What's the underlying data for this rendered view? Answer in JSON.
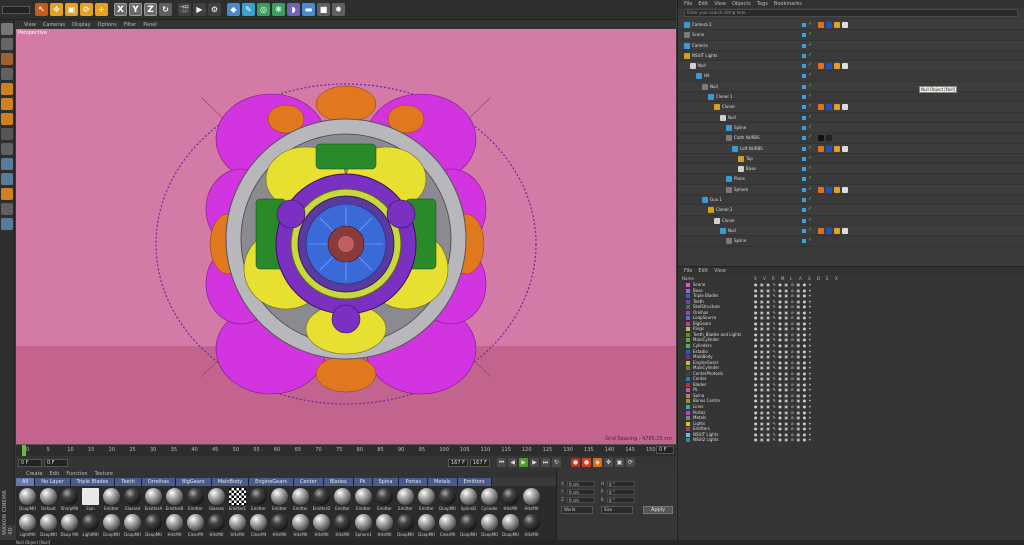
{
  "toolbar": {
    "undo_field": "",
    "xyz": [
      "X",
      "Y",
      "Z"
    ],
    "mode_icons": [
      "move-icon",
      "scale-icon",
      "rotate-icon",
      "live-select-icon",
      "cube-icon",
      "pen-icon",
      "subdivision-icon",
      "array-icon",
      "deformer-icon",
      "camera-icon",
      "light-icon"
    ]
  },
  "viewport": {
    "menu": [
      "View",
      "Cameras",
      "Display",
      "Options",
      "Filter",
      "Panel"
    ],
    "label": "Perspective",
    "grid_spacing": "Grid Spacing : 4765.25 cm"
  },
  "timeline": {
    "ticks": [
      "0",
      "5",
      "10",
      "15",
      "20",
      "25",
      "30",
      "35",
      "40",
      "45",
      "50",
      "55",
      "60",
      "65",
      "70",
      "75",
      "80",
      "85",
      "90",
      "95",
      "100",
      "105",
      "110",
      "115",
      "120",
      "125",
      "130",
      "135",
      "140",
      "145",
      "150"
    ],
    "start_frame": "0 F",
    "current_frame": "0 F",
    "end_frame": "167 F",
    "max_frame": "167 F",
    "frame_indicator": "0 F"
  },
  "material_manager": {
    "menu": [
      "Create",
      "Edit",
      "Function",
      "Texture"
    ],
    "tabs": [
      "All",
      "No Layer",
      "Triple Blades",
      "Teeth",
      "Orrelhas",
      "BigGears",
      "MainBody",
      "EngineGears",
      "Center",
      "Blades",
      "Pk",
      "Spina",
      "Portas",
      "Metals",
      "Emitters"
    ],
    "row1": [
      "DoopMtl",
      "Default",
      "SharpMtl",
      "Sian",
      "Emitter",
      "Glassed",
      "EmitterA",
      "EmitterB",
      "Emitter",
      "Glasses",
      "EmitterC",
      "Emitter",
      "Emitter",
      "Emitter",
      "EmitterD",
      "Emitter",
      "Emitter",
      "Emitter",
      "Emitter",
      "Emitter",
      "DoopMtl",
      "SplineD",
      "Cylinder",
      "HitsMtl",
      "HitsMtl",
      "LightMtl"
    ],
    "row2": [
      "DoopMtl",
      "Doop Mtl",
      "LightMtl",
      "DoopMtl",
      "DoopMtl",
      "DoopMtl",
      "HitsMtl",
      "ClearMt",
      "HitsMtl",
      "HitsMtl",
      "ClearMt",
      "HitsMtl",
      "HitsMtl",
      "HitsMtl",
      "HitsMtl",
      "Sphere1",
      "HitsMtl",
      "DoopMtl",
      "DoopMtl",
      "ClearMt",
      "DoopMtl",
      "DoopMtl",
      "DoopMtl",
      "HitsMtl",
      "HitsMtl",
      "ClearMt"
    ]
  },
  "attributes": {
    "labels": [
      "X",
      "Y",
      "Z",
      "H",
      "P",
      "B"
    ],
    "values": [
      "0 cm",
      "0 cm",
      "0 cm",
      "0 °",
      "0 °",
      "0 °"
    ],
    "world": "World",
    "size": "Size",
    "apply": "Apply"
  },
  "object_manager": {
    "menu": [
      "File",
      "Edit",
      "View",
      "Objects",
      "Tags",
      "Bookmarks"
    ],
    "search_placeholder": "Enter your search string here",
    "tooltip": "Null Object [Null]",
    "rows": [
      {
        "name": "Camera.1",
        "indent": 0
      },
      {
        "name": "Scene",
        "indent": 0
      },
      {
        "name": "Camera",
        "indent": 0
      },
      {
        "name": "NSUIT Lights",
        "indent": 0
      },
      {
        "name": "Null",
        "indent": 1
      },
      {
        "name": "Hit",
        "indent": 2
      },
      {
        "name": "Null",
        "indent": 3
      },
      {
        "name": "Cloner.1",
        "indent": 4
      },
      {
        "name": "Cloner",
        "indent": 5
      },
      {
        "name": "Null",
        "indent": 6
      },
      {
        "name": "Spline",
        "indent": 7
      },
      {
        "name": "Cloth NURBS",
        "indent": 7
      },
      {
        "name": "Loft NURBS",
        "indent": 8
      },
      {
        "name": "Top",
        "indent": 9
      },
      {
        "name": "Base",
        "indent": 9
      },
      {
        "name": "Plane",
        "indent": 7
      },
      {
        "name": "Sphere",
        "indent": 7
      },
      {
        "name": "Gun.1",
        "indent": 3
      },
      {
        "name": "Cloner.1",
        "indent": 4
      },
      {
        "name": "Cloner",
        "indent": 5
      },
      {
        "name": "Null",
        "indent": 6
      },
      {
        "name": "Spline",
        "indent": 7
      }
    ]
  },
  "layer_manager": {
    "menu": [
      "File",
      "Edit",
      "View"
    ],
    "header": "Name",
    "columns": [
      "S",
      "V",
      "R",
      "M",
      "L",
      "A",
      "G",
      "D",
      "E",
      "X"
    ],
    "rows": [
      {
        "name": "Scene",
        "color": "#d060c0"
      },
      {
        "name": "Base",
        "color": "#a060d0"
      },
      {
        "name": "Triple Blades",
        "color": "#4060c0"
      },
      {
        "name": "Teeth",
        "color": "#8040a0"
      },
      {
        "name": "SkelStructure",
        "color": "#606060"
      },
      {
        "name": "Orelhas",
        "color": "#a040c0"
      },
      {
        "name": "LoopSource",
        "color": "#4080c0"
      },
      {
        "name": "BigGears",
        "color": "#c040a0"
      },
      {
        "name": "Rings",
        "color": "#c0c040"
      },
      {
        "name": "Teeth_Blades and Lights",
        "color": "#808020"
      },
      {
        "name": "MainCylinder",
        "color": "#60a060"
      },
      {
        "name": "Cylinders",
        "color": "#40c040"
      },
      {
        "name": "Estadio",
        "color": "#2060c0"
      },
      {
        "name": "MainBody",
        "color": "#8020a0"
      },
      {
        "name": "EngineGears",
        "color": "#c0c020"
      },
      {
        "name": "MainCylinder",
        "color": "#608040"
      },
      {
        "name": "CenterPhotonb",
        "color": "#404040"
      },
      {
        "name": "Center",
        "color": "#2080c0"
      },
      {
        "name": "Blades",
        "color": "#c03030"
      },
      {
        "name": "Pk",
        "color": "#a060c0"
      },
      {
        "name": "Spina",
        "color": "#c08040"
      },
      {
        "name": "Bonus Centre",
        "color": "#80a040"
      },
      {
        "name": "Lines",
        "color": "#40a0c0"
      },
      {
        "name": "Portas",
        "color": "#c040c0"
      },
      {
        "name": "Metals",
        "color": "#808080"
      },
      {
        "name": "Lights",
        "color": "#e0c020"
      },
      {
        "name": "Emitters",
        "color": "#a04060"
      },
      {
        "name": "NSUIT Lights",
        "color": "#60c0e0"
      },
      {
        "name": "NSUI2 Lights",
        "color": "#4080a0"
      }
    ]
  },
  "status_bar": {
    "text": "Null Object [Null]"
  }
}
